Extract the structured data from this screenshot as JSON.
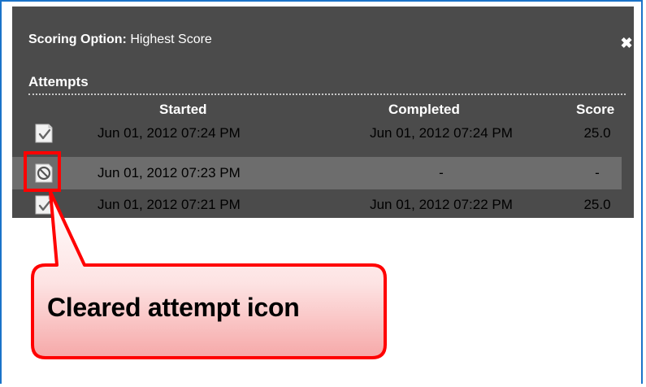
{
  "panel": {
    "scoring_label": "Scoring Option:",
    "scoring_value": "Highest Score",
    "close_symbol": "✖",
    "attempts_title": "Attempts",
    "columns": {
      "started": "Started",
      "completed": "Completed",
      "score": "Score"
    },
    "rows": [
      {
        "icon": "completed-attempt-icon",
        "started": "Jun 01, 2012 07:24 PM",
        "completed": "Jun 01, 2012 07:24 PM",
        "score": "25.0"
      },
      {
        "icon": "cleared-attempt-icon",
        "started": "Jun 01, 2012 07:23 PM",
        "completed": "-",
        "score": "-"
      },
      {
        "icon": "completed-attempt-icon",
        "started": "Jun 01, 2012 07:21 PM",
        "completed": "Jun 01, 2012 07:22 PM",
        "score": "25.0"
      }
    ]
  },
  "callout": {
    "text": "Cleared attempt icon"
  },
  "colors": {
    "panel_bg": "#4b4b4b",
    "highlight_row": "#6d6d6d",
    "callout_red": "#ff0000",
    "frame_border": "#1a73c9"
  }
}
